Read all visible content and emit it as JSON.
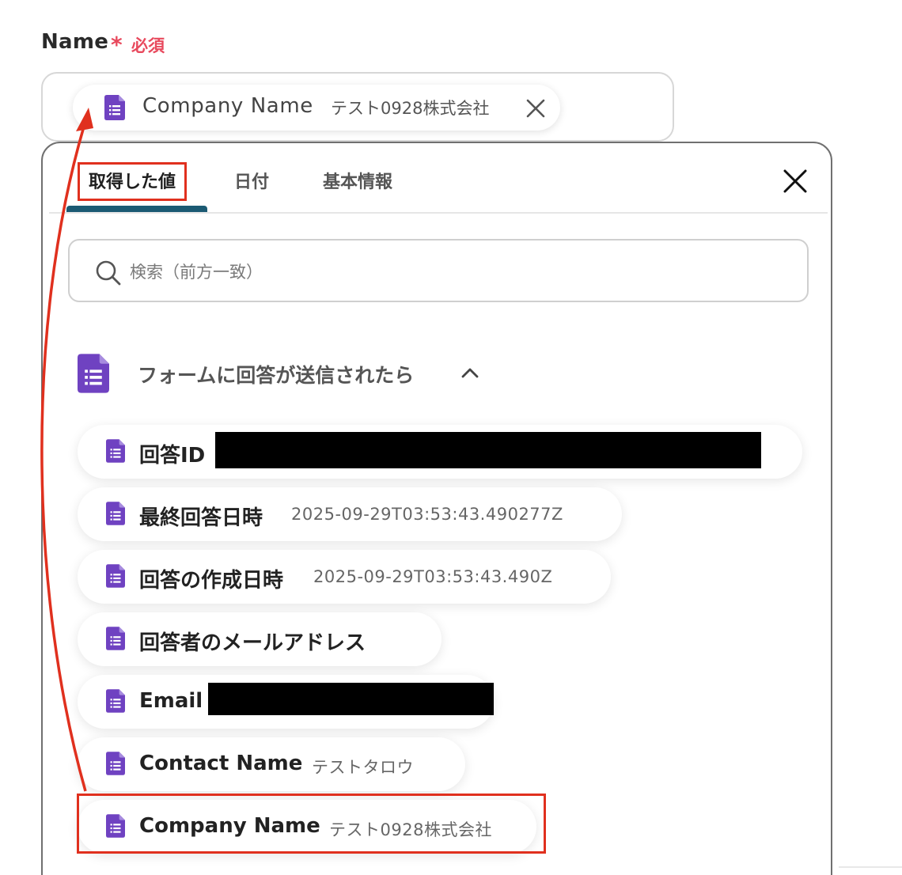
{
  "field": {
    "label": "Name",
    "required_star": "*",
    "required_text": "必須"
  },
  "selected_chip": {
    "label": "Company Name",
    "value": "テスト0928株式会社"
  },
  "tabs": [
    {
      "label": "取得した値",
      "active": true
    },
    {
      "label": "日付",
      "active": false
    },
    {
      "label": "基本情報",
      "active": false
    }
  ],
  "search": {
    "placeholder": "検索（前方一致）"
  },
  "group": {
    "title": "フォームに回答が送信されたら",
    "expanded": true
  },
  "items": [
    {
      "label": "回答ID",
      "value": ""
    },
    {
      "label": "最終回答日時",
      "value": "2025-09-29T03:53:43.490277Z"
    },
    {
      "label": "回答の作成日時",
      "value": "2025-09-29T03:53:43.490Z"
    },
    {
      "label": "回答者のメールアドレス",
      "value": ""
    },
    {
      "label": "Email",
      "value": ""
    },
    {
      "label": "Contact Name",
      "value": "テストタロウ"
    },
    {
      "label": "Company Name",
      "value": "テスト0928株式会社"
    }
  ],
  "colors": {
    "accent": "#1b5a73",
    "required": "#e8495d",
    "annotation": "#e0301e",
    "forms_icon": "#6f42c1"
  },
  "icons": {
    "forms": "google-forms-icon",
    "close": "close-icon",
    "search": "search-icon",
    "chevron": "chevron-up-icon"
  }
}
